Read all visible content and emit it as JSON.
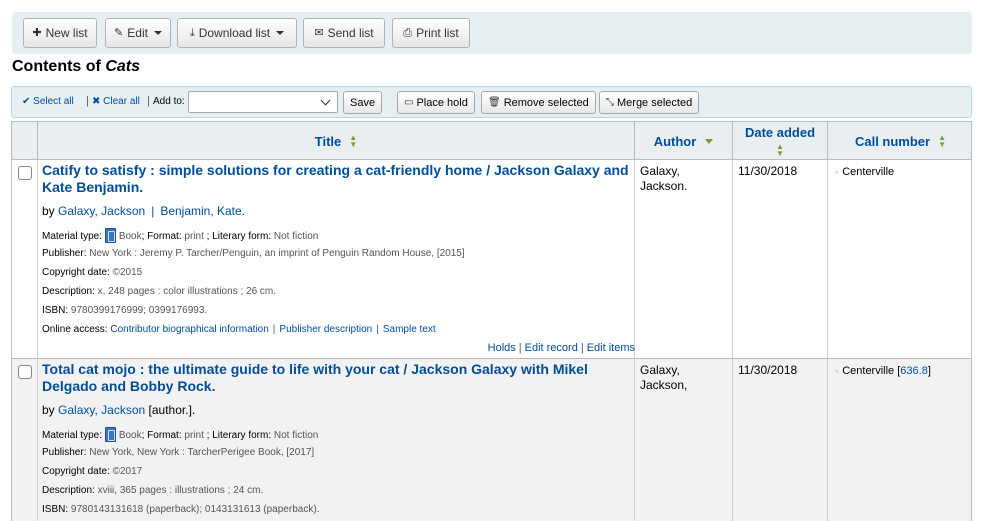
{
  "toolbar": {
    "new_list": "New list",
    "edit": "Edit",
    "download_list": "Download list",
    "send_list": "Send list",
    "print_list": "Print list"
  },
  "page": {
    "title_prefix": "Contents of",
    "list_name": "Cats"
  },
  "selection_bar": {
    "select_all": "Select all",
    "clear_all": "Clear all",
    "add_to_label": "Add to:",
    "add_to_value": "",
    "save": "Save",
    "place_hold": "Place hold",
    "remove_selected": "Remove selected",
    "merge_selected": "Merge selected"
  },
  "table": {
    "headers": {
      "title": "Title",
      "author": "Author",
      "date_added": "Date added",
      "call_number": "Call number"
    },
    "rows": [
      {
        "title": "Catify to satisfy : simple solutions for creating a cat-friendly home / Jackson Galaxy and Kate Benjamin.",
        "by": "by",
        "authors": [
          "Galaxy, Jackson",
          "Benjamin, Kate."
        ],
        "author_suffix": "",
        "material_type_label": "Material type:",
        "material_type": "Book",
        "format_label": "; Format:",
        "format": "print",
        "literary_form_label": "; Literary form:",
        "literary_form": "Not fiction",
        "publisher_label": "Publisher:",
        "publisher": "New York : Jeremy P. Tarcher/Penguin, an imprint of Penguin Random House, [2015]",
        "copyright_label": "Copyright date:",
        "copyright": "©2015",
        "description_label": "Description:",
        "description": "x, 248 pages : color illustrations ; 26 cm.",
        "isbn_label": "ISBN:",
        "isbn": "9780399176999; 0399176993.",
        "online_access_label": "Online access:",
        "online_links": [
          "Contributor biographical information",
          "Publisher description",
          "Sample text"
        ],
        "actions": [
          "Holds",
          "Edit record",
          "Edit items"
        ],
        "author_col": "Galaxy, Jackson.",
        "date_added": "11/30/2018",
        "call_location": "Centerville",
        "call_number": ""
      },
      {
        "title": "Total cat mojo : the ultimate guide to life with your cat / Jackson Galaxy with Mikel Delgado and Bobby Rock.",
        "by": "by",
        "authors": [
          "Galaxy, Jackson"
        ],
        "author_suffix": "[author.].",
        "material_type_label": "Material type:",
        "material_type": "Book",
        "format_label": "; Format:",
        "format": "print",
        "literary_form_label": "; Literary form:",
        "literary_form": "Not fiction",
        "publisher_label": "Publisher:",
        "publisher": "New York, New York : TarcherPerigee Book, [2017]",
        "copyright_label": "Copyright date:",
        "copyright": "©2017",
        "description_label": "Description:",
        "description": "xviii, 365 pages : illustrations ; 24 cm.",
        "isbn_label": "ISBN:",
        "isbn": "9780143131618 (paperback); 0143131613 (paperback).",
        "author_col": "Galaxy, Jackson,",
        "date_added": "11/30/2018",
        "call_location": "Centerville",
        "call_number": "636.8"
      }
    ]
  }
}
